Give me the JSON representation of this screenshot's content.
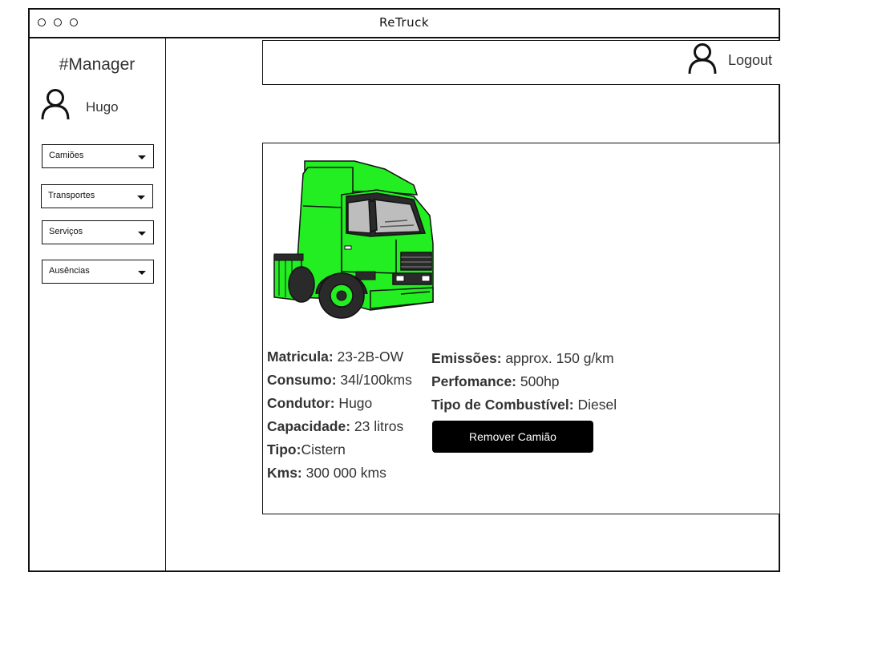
{
  "app": {
    "title": "ReTruck"
  },
  "sidebar": {
    "role_title": "#Manager",
    "user_name": "Hugo",
    "menus": [
      {
        "label": "Camiões"
      },
      {
        "label": "Transportes"
      },
      {
        "label": "Serviços"
      },
      {
        "label": "Ausências"
      }
    ]
  },
  "header": {
    "logout_label": "Logout"
  },
  "truck": {
    "image_icon": "green-truck-illustration",
    "fields": {
      "matricula_label": "Matricula:",
      "matricula_value": " 23-2B-OW",
      "consumo_label": "Consumo:",
      "consumo_value": " 34l/100kms",
      "condutor_label": "Condutor:",
      "condutor_value": " Hugo",
      "capacidade_label": "Capacidade:",
      "capacidade_value": " 23 litros",
      "tipo_label": "Tipo:",
      "tipo_value": "Cistern",
      "kms_label": "Kms:",
      "kms_value": " 300 000 kms",
      "emissoes_label": "Emissões:",
      "emissoes_value": " approx. 150 g/km",
      "performance_label": "Perfomance:",
      "performance_value": " 500hp",
      "combustivel_label": "Tipo de Combustível:",
      "combustivel_value": " Diesel"
    },
    "remove_button": "Remover Camião"
  },
  "colors": {
    "truck_body": "#22ee22",
    "button_bg": "#000000",
    "text": "#333333"
  }
}
